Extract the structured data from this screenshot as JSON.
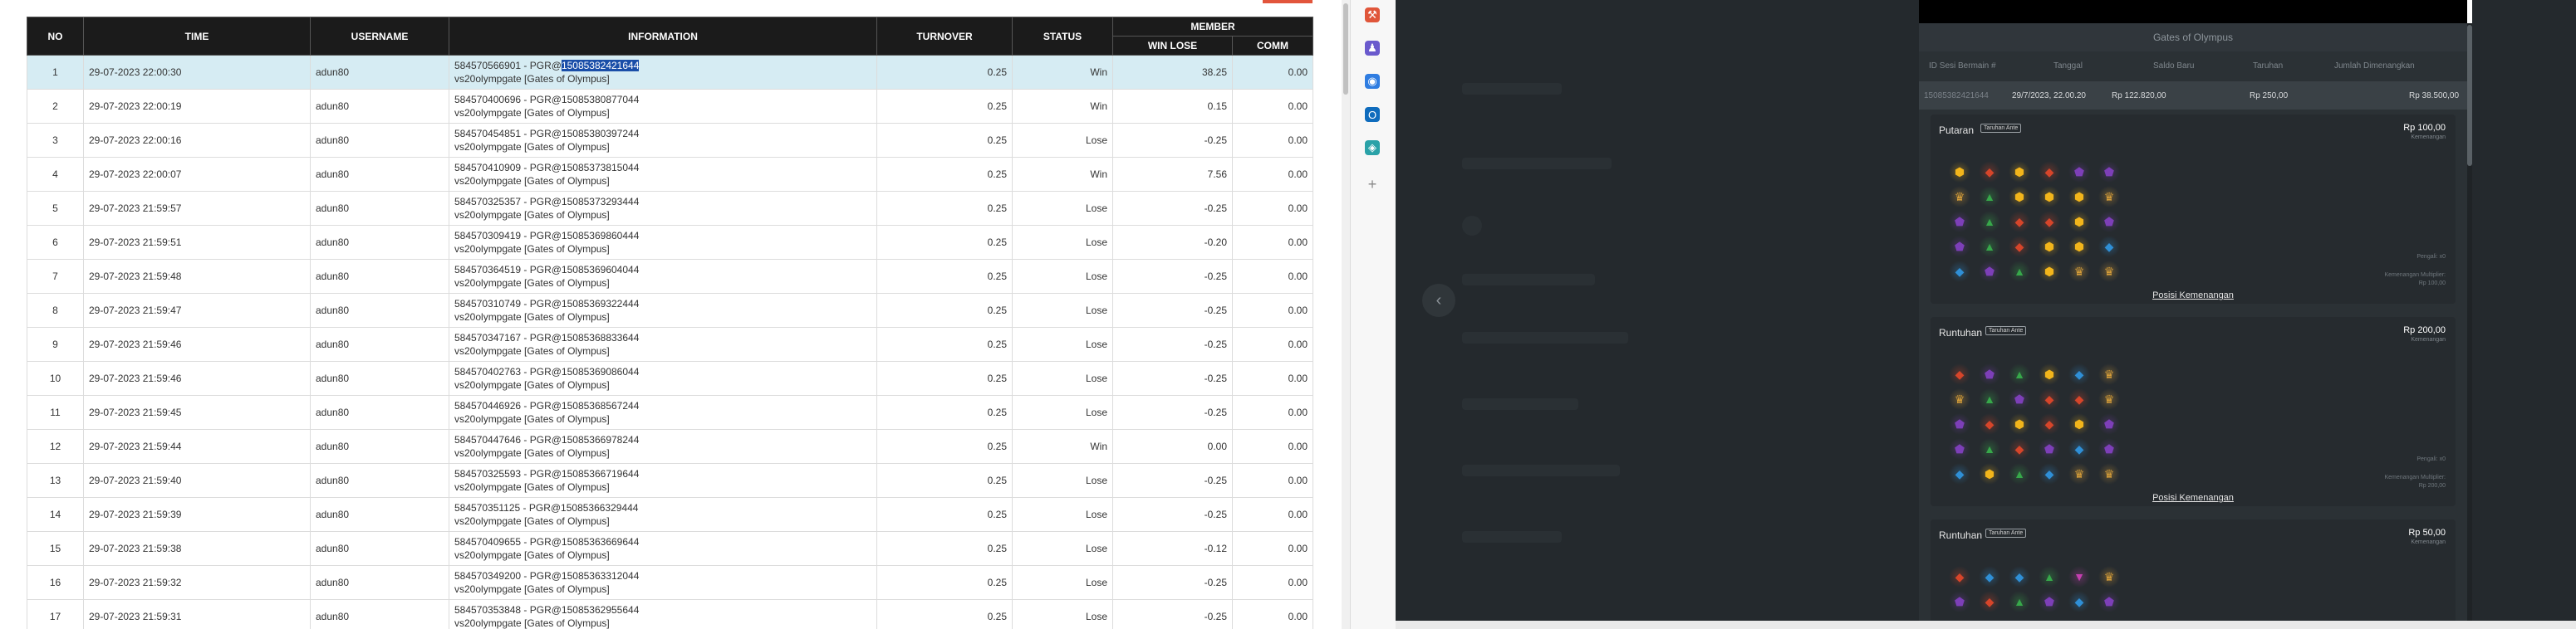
{
  "table": {
    "headers": {
      "no": "NO",
      "time": "TIME",
      "username": "USERNAME",
      "information": "INFORMATION",
      "turnover": "TURNOVER",
      "status": "STATUS",
      "member": "MEMBER",
      "win_lose": "WIN LOSE",
      "comm": "COMM"
    },
    "rows": [
      {
        "no": "1",
        "time": "29-07-2023 22:00:30",
        "username": "adun80",
        "info_prefix": "584570566901 - PGR@",
        "info_highlight": "15085382421644",
        "info_line2": "vs20olympgate [Gates of Olympus]",
        "turnover": "0.25",
        "status": "Win",
        "win_lose": "38.25",
        "comm": "0.00"
      },
      {
        "no": "2",
        "time": "29-07-2023 22:00:19",
        "username": "adun80",
        "info_prefix": "584570400696 - PGR@15085380877044",
        "info_highlight": "",
        "info_line2": "vs20olympgate [Gates of Olympus]",
        "turnover": "0.25",
        "status": "Win",
        "win_lose": "0.15",
        "comm": "0.00"
      },
      {
        "no": "3",
        "time": "29-07-2023 22:00:16",
        "username": "adun80",
        "info_prefix": "584570454851 - PGR@15085380397244",
        "info_highlight": "",
        "info_line2": "vs20olympgate [Gates of Olympus]",
        "turnover": "0.25",
        "status": "Lose",
        "win_lose": "-0.25",
        "comm": "0.00"
      },
      {
        "no": "4",
        "time": "29-07-2023 22:00:07",
        "username": "adun80",
        "info_prefix": "584570410909 - PGR@15085373815044",
        "info_highlight": "",
        "info_line2": "vs20olympgate [Gates of Olympus]",
        "turnover": "0.25",
        "status": "Win",
        "win_lose": "7.56",
        "comm": "0.00"
      },
      {
        "no": "5",
        "time": "29-07-2023 21:59:57",
        "username": "adun80",
        "info_prefix": "584570325357 - PGR@15085373293444",
        "info_highlight": "",
        "info_line2": "vs20olympgate [Gates of Olympus]",
        "turnover": "0.25",
        "status": "Lose",
        "win_lose": "-0.25",
        "comm": "0.00"
      },
      {
        "no": "6",
        "time": "29-07-2023 21:59:51",
        "username": "adun80",
        "info_prefix": "584570309419 - PGR@15085369860444",
        "info_highlight": "",
        "info_line2": "vs20olympgate [Gates of Olympus]",
        "turnover": "0.25",
        "status": "Lose",
        "win_lose": "-0.20",
        "comm": "0.00"
      },
      {
        "no": "7",
        "time": "29-07-2023 21:59:48",
        "username": "adun80",
        "info_prefix": "584570364519 - PGR@15085369604044",
        "info_highlight": "",
        "info_line2": "vs20olympgate [Gates of Olympus]",
        "turnover": "0.25",
        "status": "Lose",
        "win_lose": "-0.25",
        "comm": "0.00"
      },
      {
        "no": "8",
        "time": "29-07-2023 21:59:47",
        "username": "adun80",
        "info_prefix": "584570310749 - PGR@15085369322444",
        "info_highlight": "",
        "info_line2": "vs20olympgate [Gates of Olympus]",
        "turnover": "0.25",
        "status": "Lose",
        "win_lose": "-0.25",
        "comm": "0.00"
      },
      {
        "no": "9",
        "time": "29-07-2023 21:59:46",
        "username": "adun80",
        "info_prefix": "584570347167 - PGR@15085368833644",
        "info_highlight": "",
        "info_line2": "vs20olympgate [Gates of Olympus]",
        "turnover": "0.25",
        "status": "Lose",
        "win_lose": "-0.25",
        "comm": "0.00"
      },
      {
        "no": "10",
        "time": "29-07-2023 21:59:46",
        "username": "adun80",
        "info_prefix": "584570402763 - PGR@15085369086044",
        "info_highlight": "",
        "info_line2": "vs20olympgate [Gates of Olympus]",
        "turnover": "0.25",
        "status": "Lose",
        "win_lose": "-0.25",
        "comm": "0.00"
      },
      {
        "no": "11",
        "time": "29-07-2023 21:59:45",
        "username": "adun80",
        "info_prefix": "584570446926 - PGR@15085368567244",
        "info_highlight": "",
        "info_line2": "vs20olympgate [Gates of Olympus]",
        "turnover": "0.25",
        "status": "Lose",
        "win_lose": "-0.25",
        "comm": "0.00"
      },
      {
        "no": "12",
        "time": "29-07-2023 21:59:44",
        "username": "adun80",
        "info_prefix": "584570447646 - PGR@15085366978244",
        "info_highlight": "",
        "info_line2": "vs20olympgate [Gates of Olympus]",
        "turnover": "0.25",
        "status": "Win",
        "win_lose": "0.00",
        "comm": "0.00"
      },
      {
        "no": "13",
        "time": "29-07-2023 21:59:40",
        "username": "adun80",
        "info_prefix": "584570325593 - PGR@15085366719644",
        "info_highlight": "",
        "info_line2": "vs20olympgate [Gates of Olympus]",
        "turnover": "0.25",
        "status": "Lose",
        "win_lose": "-0.25",
        "comm": "0.00"
      },
      {
        "no": "14",
        "time": "29-07-2023 21:59:39",
        "username": "adun80",
        "info_prefix": "584570351125 - PGR@15085366329444",
        "info_highlight": "",
        "info_line2": "vs20olympgate [Gates of Olympus]",
        "turnover": "0.25",
        "status": "Lose",
        "win_lose": "-0.25",
        "comm": "0.00"
      },
      {
        "no": "15",
        "time": "29-07-2023 21:59:38",
        "username": "adun80",
        "info_prefix": "584570409655 - PGR@15085363669644",
        "info_highlight": "",
        "info_line2": "vs20olympgate [Gates of Olympus]",
        "turnover": "0.25",
        "status": "Lose",
        "win_lose": "-0.12",
        "comm": "0.00"
      },
      {
        "no": "16",
        "time": "29-07-2023 21:59:32",
        "username": "adun80",
        "info_prefix": "584570349200 - PGR@15085363312044",
        "info_highlight": "",
        "info_line2": "vs20olympgate [Gates of Olympus]",
        "turnover": "0.25",
        "status": "Lose",
        "win_lose": "-0.25",
        "comm": "0.00"
      },
      {
        "no": "17",
        "time": "29-07-2023 21:59:31",
        "username": "adun80",
        "info_prefix": "584570353848 - PGR@15085362955644",
        "info_highlight": "",
        "info_line2": "vs20olympgate [Gates of Olympus]",
        "turnover": "0.25",
        "status": "Lose",
        "win_lose": "-0.25",
        "comm": "0.00"
      }
    ]
  },
  "side_icons": [
    {
      "name": "toolbox-icon",
      "glyph": "⚒",
      "color": "#e0563a"
    },
    {
      "name": "people-icon",
      "glyph": "♟",
      "color": "#6a5acd"
    },
    {
      "name": "copilot-icon",
      "glyph": "◉",
      "color": "#2f7de1"
    },
    {
      "name": "outlook-icon",
      "glyph": "O",
      "color": "#0f6cbd"
    },
    {
      "name": "edge-drop-icon",
      "glyph": "◈",
      "color": "#2aa2a8"
    },
    {
      "name": "add-icon",
      "glyph": "+",
      "color": "#888888"
    }
  ],
  "colors": {
    "win": "#3aa33a",
    "lose": "#e02a2a",
    "header_bg": "#1b1b1b",
    "selected_row": "#d6ecf3",
    "selection": "#1a4ea8"
  },
  "history": {
    "title": "Gates of Olympus",
    "columns": {
      "session_id": "ID Sesi Bermain #",
      "date": "Tanggal",
      "balance": "Saldo Baru",
      "bet": "Taruhan",
      "win_amount": "Jumlah Dimenangkan"
    },
    "values": {
      "session_id": "15085382421644",
      "date": "29/7/2023, 22.00.20",
      "balance": "Rp 122.820,00",
      "bet": "Rp 250,00",
      "win_amount": "Rp 38.500,00"
    },
    "spins": [
      {
        "type": "Putaran",
        "badge": "Taruhan Ante",
        "amount": "Rp 100,00",
        "sub": "Kemenangan",
        "note1": "Pengali: x0",
        "note2": "Kemenangan Multiplier:",
        "note3": "Rp 100,00",
        "link": "Posisi Kemenangan"
      },
      {
        "type": "Runtuhan",
        "badge": "Taruhan Ante",
        "amount": "Rp 200,00",
        "sub": "Kemenangan",
        "note1": "Pengali: x0",
        "note2": "Kemenangan Multiplier:",
        "note3": "Rp 200,00",
        "link": "Posisi Kemenangan"
      },
      {
        "type": "Runtuhan",
        "badge": "Taruhan Ante",
        "amount": "Rp 50,00",
        "sub": "Kemenangan",
        "note1": "",
        "note2": "",
        "note3": "",
        "link": ""
      }
    ],
    "grids": [
      [
        "yellow-gem",
        "red-gem",
        "yellow-gem",
        "red-gem",
        "purple-gem",
        "purple-gem",
        "crown",
        "green-gem",
        "yellow-gem",
        "yellow-gem",
        "yellow-gem",
        "crown",
        "purple-gem",
        "green-gem",
        "red-gem",
        "red-gem",
        "yellow-gem",
        "purple-gem",
        "purple-gem",
        "green-gem",
        "red-gem",
        "yellow-gem",
        "yellow-gem",
        "blue-gem",
        "blue-gem",
        "purple-gem",
        "green-gem",
        "yellow-gem",
        "crown",
        "crown"
      ],
      [
        "red-gem",
        "purple-gem",
        "green-gem",
        "yellow-gem",
        "blue-gem",
        "crown",
        "crown",
        "green-gem",
        "purple-gem",
        "red-gem",
        "red-gem",
        "crown",
        "purple-gem",
        "red-gem",
        "yellow-gem",
        "red-gem",
        "yellow-gem",
        "purple-gem",
        "purple-gem",
        "green-gem",
        "red-gem",
        "purple-gem",
        "blue-gem",
        "purple-gem",
        "blue-gem",
        "yellow-gem",
        "green-gem",
        "blue-gem",
        "crown",
        "crown"
      ],
      [
        "red-gem",
        "blue-gem",
        "blue-gem",
        "green-gem",
        "pink-gem",
        "crown",
        "purple-gem",
        "red-gem",
        "green-gem",
        "purple-gem",
        "blue-gem",
        "purple-gem"
      ]
    ]
  }
}
